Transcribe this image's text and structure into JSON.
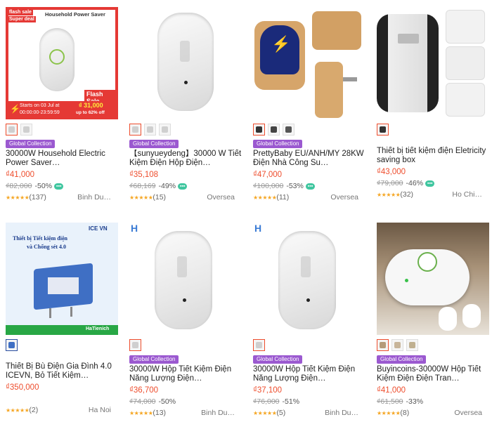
{
  "products": [
    {
      "badge": "Global Collection",
      "title": "30000W Household Electric Power Saver…",
      "price": "₫41,000",
      "original_price": "₫82,000",
      "discount": "-50%",
      "rating_count": "(137)",
      "location": "Binh Du…",
      "image_overlay": {
        "flash_sale_corner": "flash sale",
        "super_deal": "Super deal",
        "heading": "Household Power Saver",
        "flash_sale_banner": "Flash Sale",
        "starts": "Starts on 03 Jul at",
        "time": "00:00:00-23:59:59",
        "sale_price": "₫ 31,000",
        "upto": "up to 62% off"
      },
      "thumb_count": 2
    },
    {
      "badge": "Global Collection",
      "title": "【sunyueydeng】30000 W Tiết Kiệm Điện Hộp Điện…",
      "price": "₫35,108",
      "original_price": "₫68,169",
      "discount": "-49%",
      "rating_count": "(15)",
      "location": "Oversea",
      "thumb_count": 3
    },
    {
      "badge": "Global Collection",
      "title": "PrettyBaby EU/ANH/MY 28KW Điện Nhà Công Su…",
      "price": "₫47,000",
      "original_price": "₫100,000",
      "discount": "-53%",
      "rating_count": "(11)",
      "location": "Oversea",
      "thumb_count": 3
    },
    {
      "badge": "",
      "title": "Thiết bị tiết kiệm điện Eletricity saving box",
      "price": "₫43,000",
      "original_price": "₫79,000",
      "discount": "-46%",
      "rating_count": "(32)",
      "location": "Ho Chi…",
      "thumb_count": 1
    },
    {
      "badge": "",
      "title": "Thiết Bị Bù Điện Gia Đình 4.0 ICEVN, Bỏ Tiết Kiệm…",
      "price": "₫350,000",
      "original_price": "",
      "discount": "",
      "rating_count": "(2)",
      "location": "Ha Noi",
      "image_overlay": {
        "brand": "ICE VN",
        "heading_line1": "Thiết bị Tiết kiệm điện",
        "heading_line2": "và Chống sét 4.0",
        "footer": "HaTienich"
      },
      "thumb_count": 1
    },
    {
      "badge": "Global Collection",
      "title": "30000W Hộp Tiết Kiệm Điện Năng Lượng Điện…",
      "price": "₫36,700",
      "original_price": "₫74,000",
      "discount": "-50%",
      "rating_count": "(13)",
      "location": "Binh Du…",
      "thumb_count": 1
    },
    {
      "badge": "Global Collection",
      "title": "30000W Hộp Tiết Kiệm Điện Năng Lượng Điện…",
      "price": "₫37,100",
      "original_price": "₫76,000",
      "discount": "-51%",
      "rating_count": "(5)",
      "location": "Binh Du…",
      "thumb_count": 1
    },
    {
      "badge": "Global Collection",
      "title": "Buyincoins-30000W Hộp Tiết Kiệm Điện Điện Tran…",
      "price": "₫41,000",
      "original_price": "₫61,500",
      "discount": "-33%",
      "rating_count": "(8)",
      "location": "Oversea",
      "thumb_count": 3
    }
  ],
  "stars": "★★★★★",
  "colors": {
    "price": "#ee4d2d",
    "badge": "#9b59d0",
    "star": "#f5a623"
  }
}
